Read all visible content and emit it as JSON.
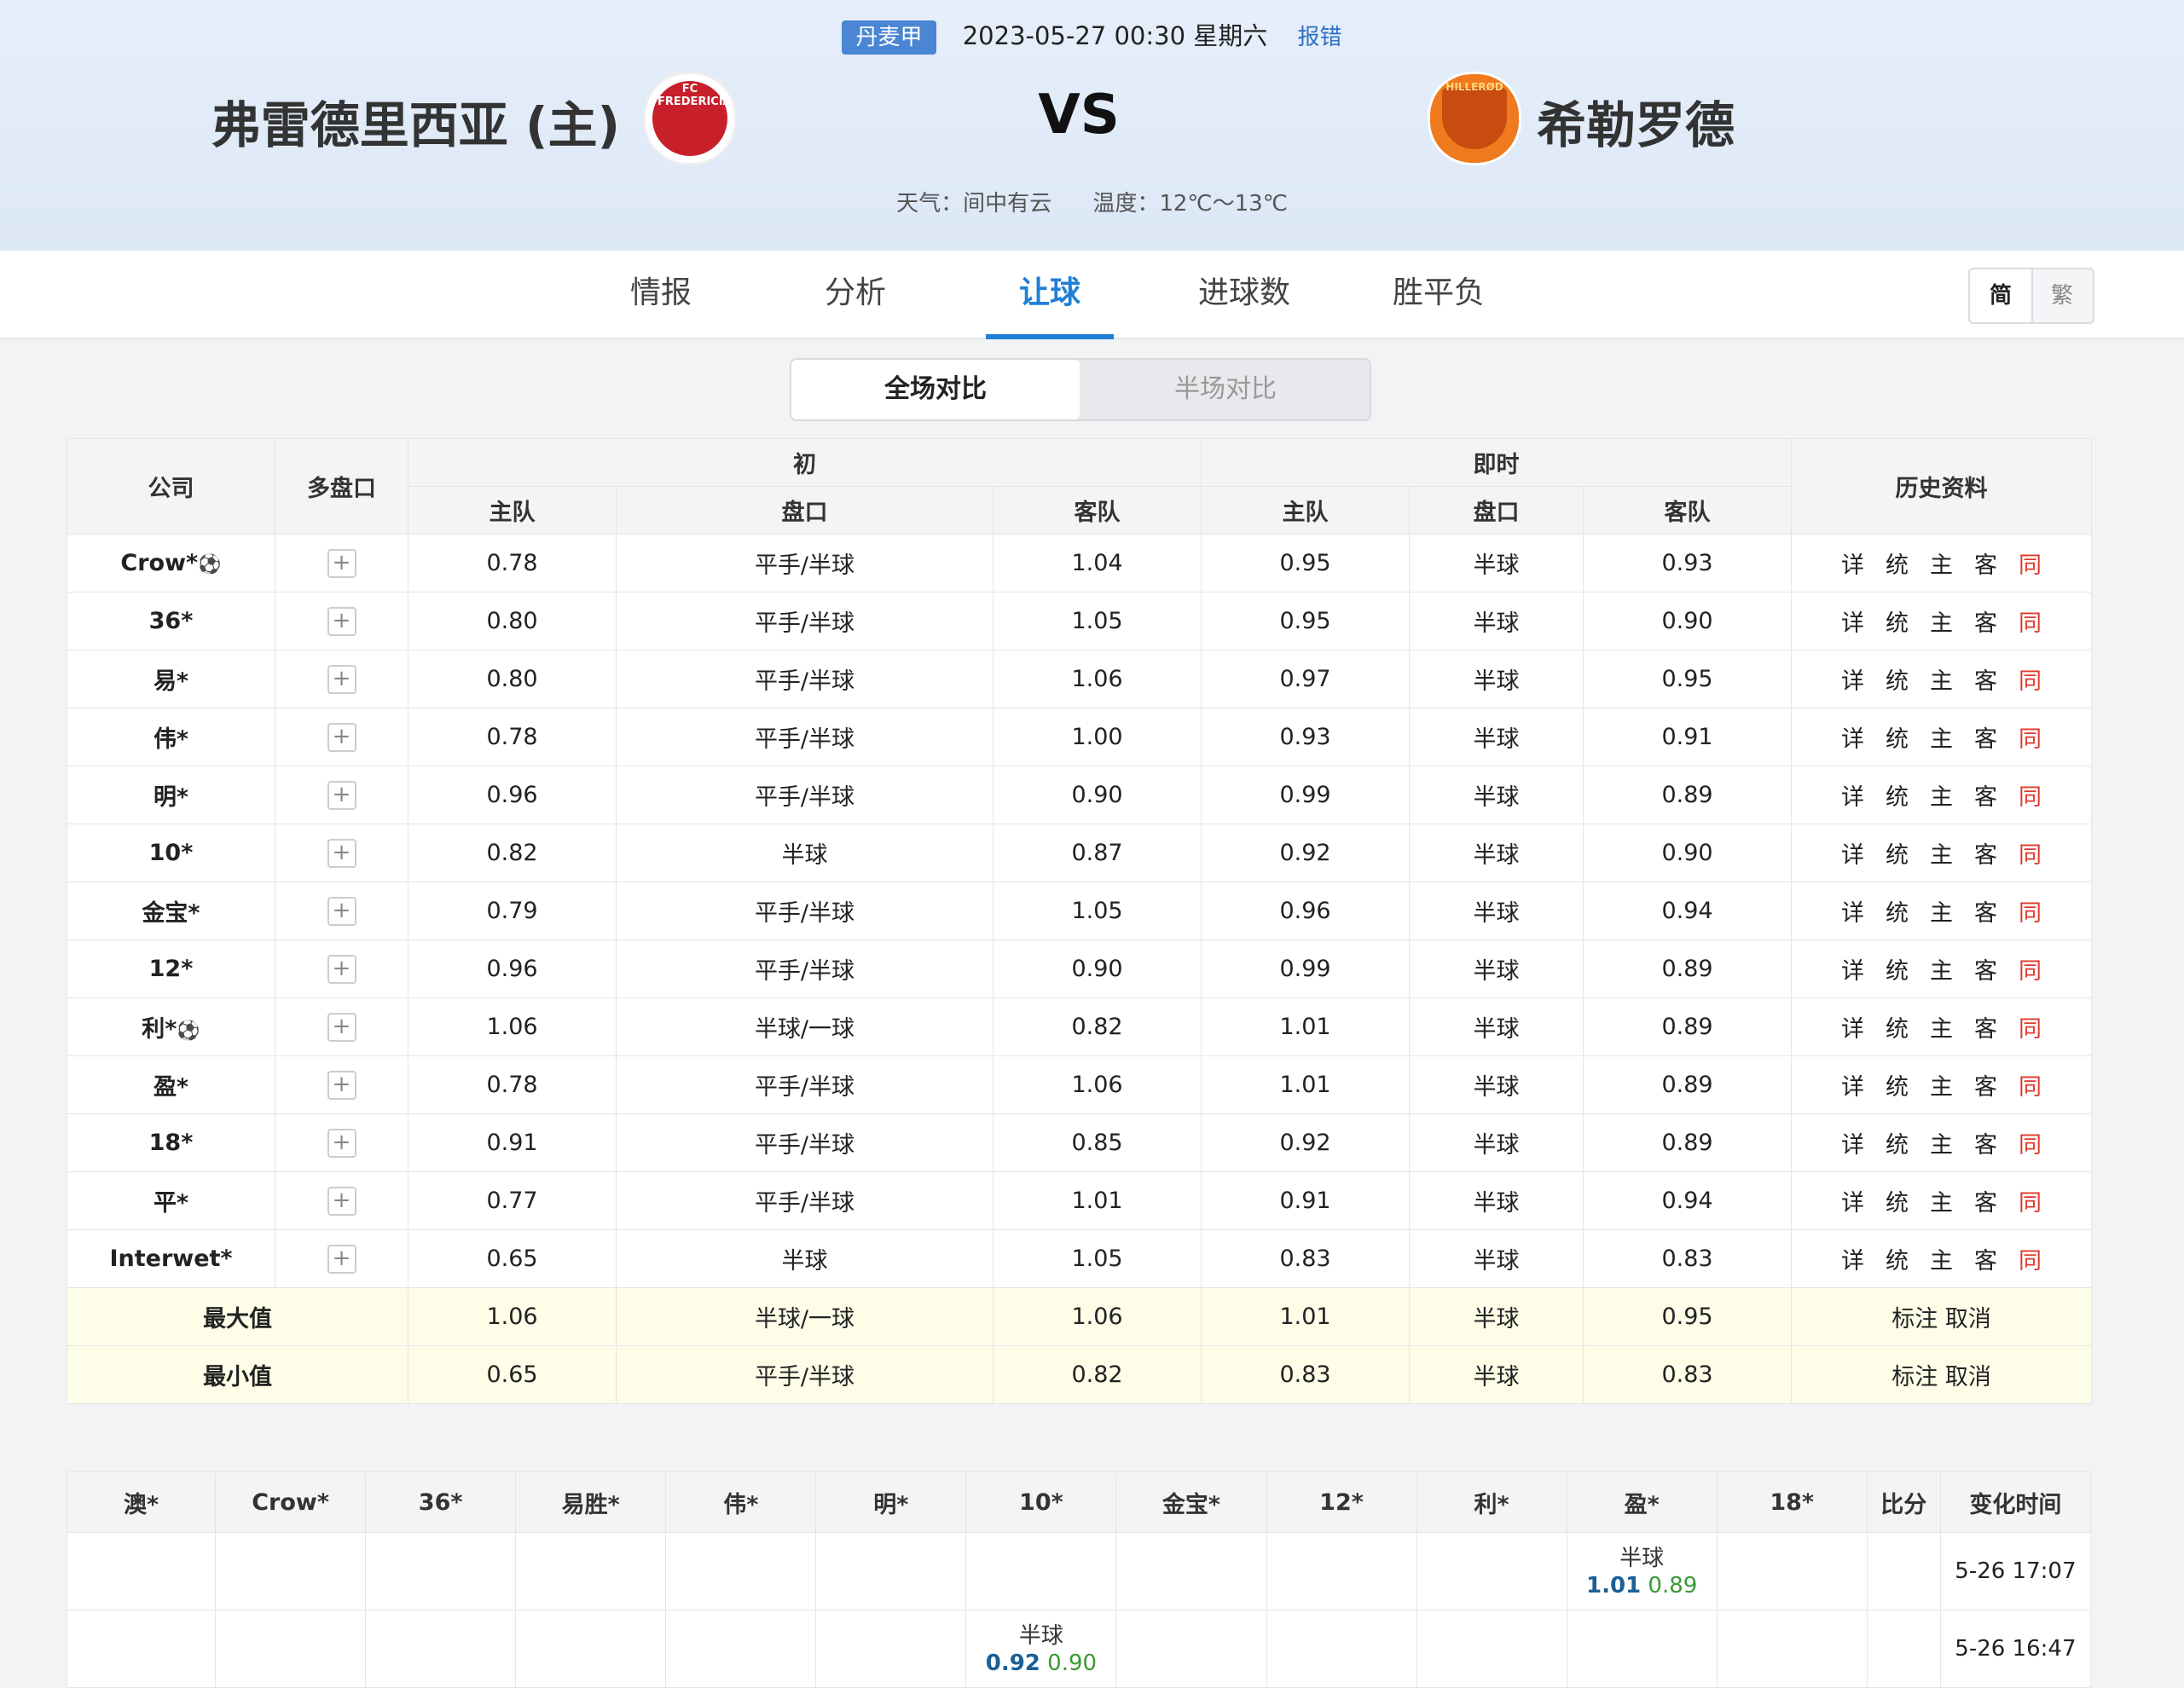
{
  "match": {
    "league": "丹麦甲",
    "datetime": "2023-05-27 00:30 星期六",
    "report": "报错",
    "home": "弗雷德里西亚 (主)",
    "away": "希勒罗德",
    "vs": "VS",
    "home_logo_text": "FC FREDERICIA",
    "away_logo_text": "HILLERØD",
    "weather": "天气：间中有云",
    "temperature": "温度：12℃～13℃"
  },
  "tabs": [
    "情报",
    "分析",
    "让球",
    "进球数",
    "胜平负"
  ],
  "active_tab": "让球",
  "lang": {
    "simplified": "简",
    "traditional": "繁"
  },
  "segment": {
    "full": "全场对比",
    "half": "半场对比"
  },
  "table": {
    "headers": {
      "company": "公司",
      "multi": "多盘口",
      "initial": "初",
      "live": "即时",
      "history": "历史资料",
      "home": "主队",
      "line": "盘口",
      "away": "客队"
    },
    "history_links": [
      "详",
      "统",
      "主",
      "客",
      "同"
    ],
    "rows": [
      {
        "company": "Crow*",
        "ball": true,
        "ih": "0.78",
        "il": "平手/半球",
        "ia": "1.04",
        "lh": "0.95",
        "ll": "半球",
        "la": "0.93"
      },
      {
        "company": "36*",
        "ball": false,
        "ih": "0.80",
        "il": "平手/半球",
        "ia": "1.05",
        "lh": "0.95",
        "ll": "半球",
        "la": "0.90"
      },
      {
        "company": "易*",
        "ball": false,
        "ih": "0.80",
        "il": "平手/半球",
        "ia": "1.06",
        "lh": "0.97",
        "ll": "半球",
        "la": "0.95"
      },
      {
        "company": "伟*",
        "ball": false,
        "ih": "0.78",
        "il": "平手/半球",
        "ia": "1.00",
        "lh": "0.93",
        "ll": "半球",
        "la": "0.91"
      },
      {
        "company": "明*",
        "ball": false,
        "ih": "0.96",
        "il": "平手/半球",
        "ia": "0.90",
        "lh": "0.99",
        "ll": "半球",
        "la": "0.89"
      },
      {
        "company": "10*",
        "ball": false,
        "ih": "0.82",
        "il": "半球",
        "ia": "0.87",
        "lh": "0.92",
        "ll": "半球",
        "la": "0.90"
      },
      {
        "company": "金宝*",
        "ball": false,
        "ih": "0.79",
        "il": "平手/半球",
        "ia": "1.05",
        "lh": "0.96",
        "ll": "半球",
        "la": "0.94"
      },
      {
        "company": "12*",
        "ball": false,
        "ih": "0.96",
        "il": "平手/半球",
        "ia": "0.90",
        "lh": "0.99",
        "ll": "半球",
        "la": "0.89"
      },
      {
        "company": "利*",
        "ball": true,
        "ih": "1.06",
        "il": "半球/一球",
        "ia": "0.82",
        "lh": "1.01",
        "ll": "半球",
        "la": "0.89"
      },
      {
        "company": "盈*",
        "ball": false,
        "ih": "0.78",
        "il": "平手/半球",
        "ia": "1.06",
        "lh": "1.01",
        "ll": "半球",
        "la": "0.89"
      },
      {
        "company": "18*",
        "ball": false,
        "ih": "0.91",
        "il": "平手/半球",
        "ia": "0.85",
        "lh": "0.92",
        "ll": "半球",
        "la": "0.89"
      },
      {
        "company": "平*",
        "ball": false,
        "ih": "0.77",
        "il": "平手/半球",
        "ia": "1.01",
        "lh": "0.91",
        "ll": "半球",
        "la": "0.94"
      },
      {
        "company": "Interwet*",
        "ball": false,
        "ih": "0.65",
        "il": "半球",
        "ia": "1.05",
        "lh": "0.83",
        "ll": "半球",
        "la": "0.83"
      }
    ],
    "summary": [
      {
        "label": "最大值",
        "ih": "1.06",
        "il": "半球/一球",
        "ia": "1.06",
        "lh": "1.01",
        "ll": "半球",
        "la": "0.95",
        "action": "标注 取消"
      },
      {
        "label": "最小值",
        "ih": "0.65",
        "il": "平手/半球",
        "ia": "0.82",
        "lh": "0.83",
        "ll": "半球",
        "la": "0.83",
        "action": "标注 取消"
      }
    ]
  },
  "changes": {
    "headers": [
      "澳*",
      "Crow*",
      "36*",
      "易胜*",
      "伟*",
      "明*",
      "10*",
      "金宝*",
      "12*",
      "利*",
      "盈*",
      "18*",
      "比分",
      "变化时间"
    ],
    "rows": [
      {
        "col": 10,
        "line": "半球",
        "home": "1.01",
        "away": "0.89",
        "time": "5-26 17:07"
      },
      {
        "col": 6,
        "line": "半球",
        "home": "0.92",
        "away": "0.90",
        "time": "5-26 16:47"
      }
    ]
  },
  "colors": {
    "accent": "#1f7fd6",
    "same_link": "#e0392b",
    "home_odds": "#1b5f96",
    "away_odds": "#3a9a34"
  }
}
